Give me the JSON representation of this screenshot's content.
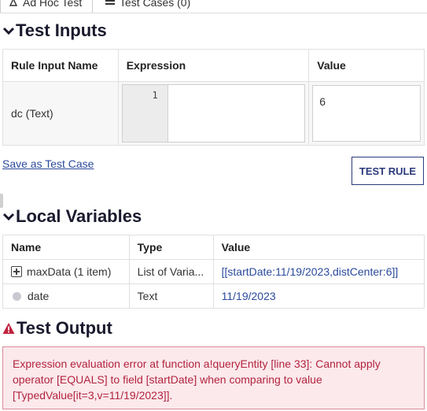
{
  "tabs": [
    {
      "label": "Ad Hoc Test"
    },
    {
      "label": "Test Cases (0)"
    }
  ],
  "test_inputs": {
    "title": "Test Inputs",
    "columns": [
      "Rule Input Name",
      "Expression",
      "Value"
    ],
    "rows": [
      {
        "name": "dc (Text)",
        "line_number": "1",
        "expression": "",
        "value": "6"
      }
    ]
  },
  "actions": {
    "save_test_case": "Save as Test Case",
    "test_rule": "TEST RULE"
  },
  "local_variables": {
    "title": "Local Variables",
    "columns": [
      "Name",
      "Type",
      "Value"
    ],
    "rows": [
      {
        "icon": "expand-icon",
        "name": "maxData (1 item)",
        "type": "List of Varia...",
        "value": "[[startDate:11/19/2023,distCenter:6]]"
      },
      {
        "icon": "dot-icon",
        "name": "date",
        "type": "Text",
        "value": "11/19/2023"
      }
    ]
  },
  "test_output": {
    "title": "Test Output",
    "error": "Expression evaluation error at function a!queryEntity [line 33]: Cannot apply operator [EQUALS] to field [startDate] when comparing to value [TypedValue[it=3,v=11/19/2023]]."
  },
  "colors": {
    "link": "#2b4a9c",
    "error_text": "#b3243e",
    "error_bg": "#fbe9ec",
    "warning": "#c0233e"
  }
}
